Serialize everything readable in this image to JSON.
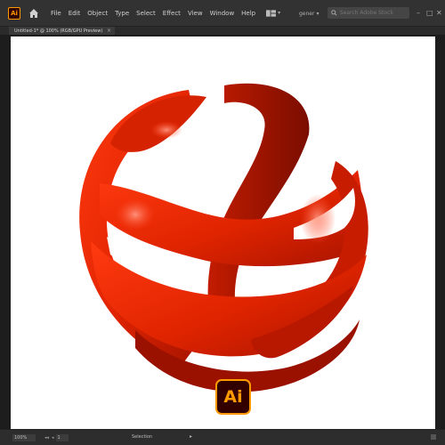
{
  "app": {
    "logo_text": "Ai",
    "menu": [
      "File",
      "Edit",
      "Object",
      "Type",
      "Select",
      "Effect",
      "View",
      "Window",
      "Help"
    ],
    "workspace": "gener",
    "search_placeholder": "Search Adobe Stock"
  },
  "document": {
    "tab_title": "Untitled-1* @ 100% (RGB/GPU Preview)",
    "close_label": "×"
  },
  "artwork": {
    "badge_text": "Ai",
    "colors": {
      "primary": "#e62a00",
      "dark": "#8f0f00",
      "highlight": "#ff6a4a",
      "badge_bg": "#330000",
      "badge_border": "#ff9a00"
    }
  },
  "status": {
    "zoom": "100%",
    "page": "1",
    "tool": "Selection"
  }
}
